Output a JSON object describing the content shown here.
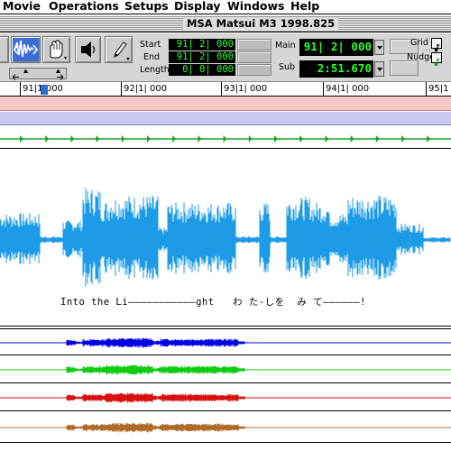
{
  "menubar": {
    "items": [
      "Movie",
      "Operations",
      "Setups",
      "Display",
      "Windows",
      "Help"
    ]
  },
  "window": {
    "title": "MSA Matsui M3 1998.825"
  },
  "toolbar": {
    "tool_icons": [
      "zoom-waveform-icon",
      "grabber-hand-icon",
      "speaker-icon",
      "pencil-icon"
    ],
    "selection": {
      "start_label": "Start",
      "start_value": "91| 2| 000",
      "end_label": "End",
      "end_value": "91| 2| 000",
      "length_label": "Length",
      "length_value": "0| 0| 000"
    },
    "counters": {
      "main_label": "Main",
      "main_value": "91| 2| 000",
      "sub_label": "Sub",
      "sub_value": "2:51.670"
    },
    "grid_label": "Grid",
    "nudge_label": "Nudge"
  },
  "ruler": {
    "labels": [
      "91|1|000",
      "92|1| 000",
      "93|1| 000",
      "94|1| 000",
      "95|1"
    ]
  },
  "lyrics": {
    "line": "Into the Li―――――――――――ght   わ た-しを  み て――――――!"
  },
  "tracks": {
    "main_waveform_color": "#1e9be6",
    "marker_color": "#1aa51a",
    "colors": [
      "#0000e0",
      "#10cc10",
      "#d81010",
      "#b06a28"
    ]
  }
}
